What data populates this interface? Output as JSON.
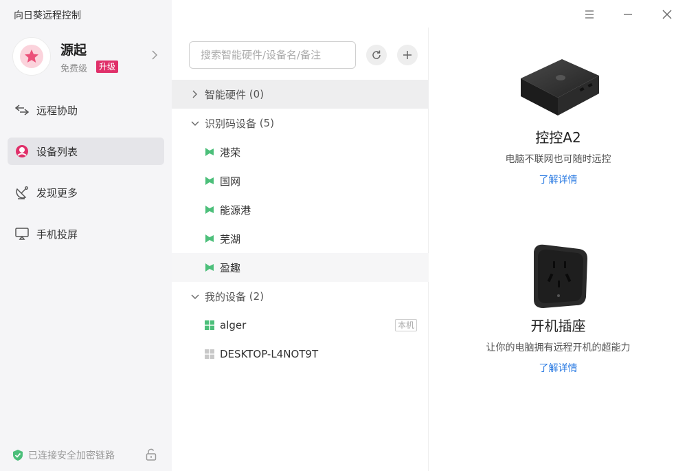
{
  "app": {
    "title": "向日葵远程控制"
  },
  "user": {
    "name": "源起",
    "tier": "免费级",
    "upgrade_label": "升级"
  },
  "nav": {
    "items": [
      {
        "label": "远程协助",
        "icon": "remote-assist-icon"
      },
      {
        "label": "设备列表",
        "icon": "device-list-icon",
        "active": true
      },
      {
        "label": "发现更多",
        "icon": "discover-icon"
      },
      {
        "label": "手机投屏",
        "icon": "screen-mirror-icon"
      }
    ]
  },
  "status": {
    "text": "已连接安全加密链路"
  },
  "search": {
    "placeholder": "搜索智能硬件/设备名/备注"
  },
  "tree": {
    "smart_hw": {
      "label": "智能硬件",
      "count": "(0)"
    },
    "idcode": {
      "label": "识别码设备",
      "count": "(5)",
      "devices": [
        "港荣",
        "国网",
        "能源港",
        "芜湖",
        "盈趣"
      ]
    },
    "mine": {
      "label": "我的设备",
      "count": "(2)",
      "devices": [
        {
          "name": "alger",
          "badge": "本机"
        },
        {
          "name": "DESKTOP-L4NOT9T"
        }
      ]
    }
  },
  "promos": [
    {
      "title": "控控A2",
      "desc": "电脑不联网也可随时远控",
      "link": "了解详情"
    },
    {
      "title": "开机插座",
      "desc": "让你的电脑拥有远程开机的超能力",
      "link": "了解详情"
    }
  ],
  "colors": {
    "accent": "#e0306a",
    "link": "#2a7ae2",
    "device_green": "#4cbf7a"
  }
}
